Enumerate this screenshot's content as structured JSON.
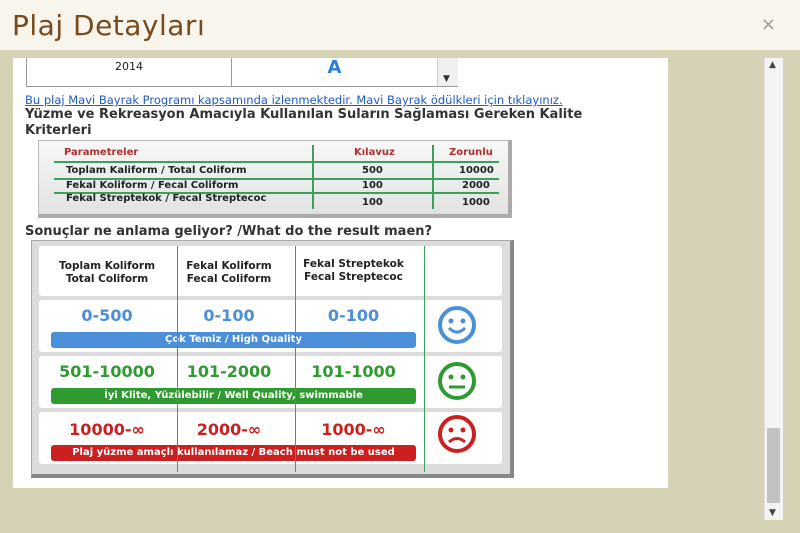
{
  "window": {
    "title": "Plaj Detayları",
    "close_label": "×"
  },
  "history": {
    "year": "2014",
    "grade": "A"
  },
  "blue_flag_link": "Bu plaj Mavi Bayrak Programı kapsamında izlenmektedir. Mavi Bayrak ödülkleri için tıklayınız.",
  "criteria_title": "Yüzme ve Rekreasyon Amacıyla Kullanılan Suların Sağlaması Gereken Kalite Kriterleri",
  "param_table": {
    "headers": {
      "param": "Parametreler",
      "guide": "Kılavuz",
      "mandatory": "Zorunlu"
    },
    "rows": [
      {
        "name": "Toplam Kaliform / Total Coliform",
        "guide": "500",
        "mandatory": "10000"
      },
      {
        "name": "Fekal Koliform / Fecal Coliform",
        "guide": "100",
        "mandatory": "2000"
      },
      {
        "name": "Fekal Streptekok / Fecal Streptecoc",
        "guide": "100",
        "mandatory": "1000"
      }
    ]
  },
  "result_question": "Sonuçlar ne anlama geliyor? /What do the result maen?",
  "result_table": {
    "headers": [
      {
        "tr": "Toplam Koliform",
        "en": "Total Coliform"
      },
      {
        "tr": "Fekal Koliform",
        "en": "Fecal Coliform"
      },
      {
        "tr": "Fekal Streptekok",
        "en": "Fecal Streptecoc"
      }
    ],
    "rows": [
      {
        "values": [
          "0-500",
          "0-100",
          "0-100"
        ],
        "label": "Çok Temiz / High Quality",
        "color": "#4a8fd8",
        "smiley": "happy-face-icon"
      },
      {
        "values": [
          "501-10000",
          "101-2000",
          "101-1000"
        ],
        "label": "İyi Klite, Yüzülebilir / Well Quality, swimmable",
        "color": "#2f9a2f",
        "smiley": "neutral-face-icon"
      },
      {
        "values": [
          "10000-∞",
          "2000-∞",
          "1000-∞"
        ],
        "label": "Plaj yüzme amaçlı kullanılamaz / Beach must not be used",
        "color": "#cc1f1f",
        "smiley": "sad-face-icon"
      }
    ]
  }
}
